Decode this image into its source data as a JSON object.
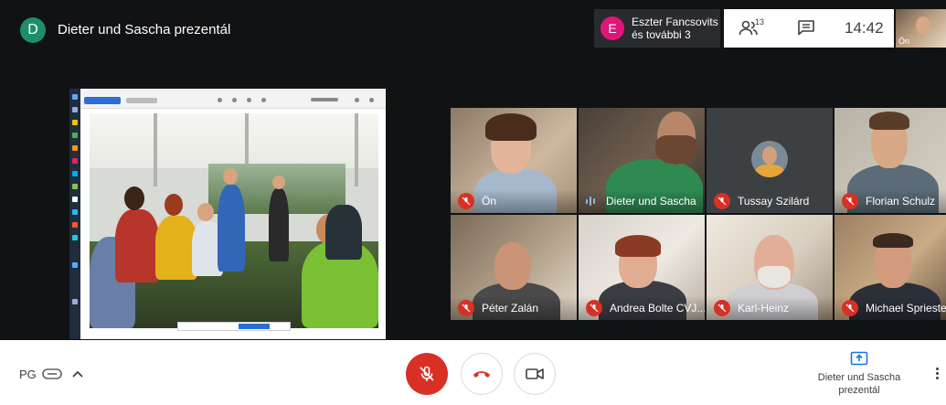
{
  "header": {
    "presenter_initial": "D",
    "presenter_title": "Dieter und Sascha prezentál",
    "speaker_initial": "E",
    "speaker_name_line1": "Eszter Fancsovits",
    "speaker_name_line2": "és további 3",
    "people_count": "13",
    "clock": "14:42",
    "self_label": "Ön"
  },
  "participants": [
    {
      "name": "Ön",
      "muted": true
    },
    {
      "name": "Dieter und Sascha",
      "muted": false,
      "speaking": true
    },
    {
      "name": "Tussay Szilárd",
      "muted": true
    },
    {
      "name": "Florian Schulz",
      "muted": true
    },
    {
      "name": "Péter Zalán",
      "muted": true
    },
    {
      "name": "Andrea Bolte CVJ...",
      "muted": true
    },
    {
      "name": "Karl-Heinz",
      "muted": true
    },
    {
      "name": "Michael Spriester",
      "muted": true
    }
  ],
  "footer": {
    "meeting_initials": "PG",
    "present_line1": "Dieter und Sascha",
    "present_line2": "prezentál"
  },
  "colors": {
    "accent_red": "#d93025",
    "presenter_avatar": "#1e8e6a",
    "speaker_avatar": "#e0157a",
    "speaking_indicator": "#8ab4f8"
  },
  "icons": [
    "people-icon",
    "chat-icon",
    "mic-off-icon",
    "hangup-icon",
    "camera-icon",
    "present-icon",
    "more-vert-icon",
    "link-icon",
    "chevron-up-icon"
  ]
}
